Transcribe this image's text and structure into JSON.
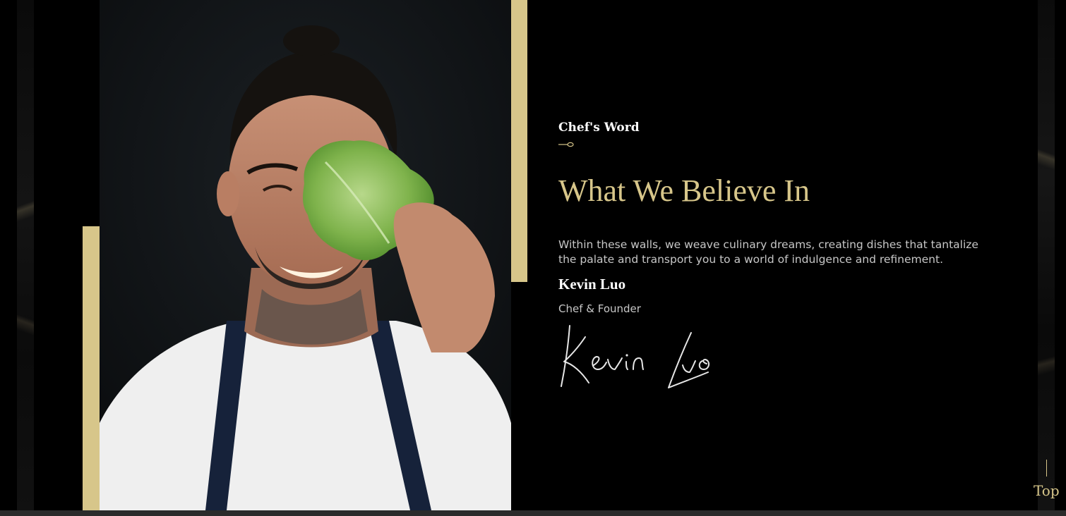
{
  "section": {
    "eyebrow": "Chef's Word",
    "heading": "What We Believe In",
    "body": "Within these walls, we weave culinary dreams, creating dishes that tantalize the palate and transport you to a world of indulgence and refinement.",
    "author_name": "Kevin Luo",
    "author_role": "Chef & Founder",
    "signature_text": "Kevin Luo"
  },
  "scroll_top": {
    "label": "Top"
  },
  "colors": {
    "accent_gold": "#d7c68a",
    "background": "#000000",
    "body_text": "#c7c7c7",
    "heading_white": "#ffffff"
  },
  "icons": {
    "eyebrow_ornament": "spoon-divider-icon",
    "scroll_top_line": "vertical-line-icon"
  }
}
